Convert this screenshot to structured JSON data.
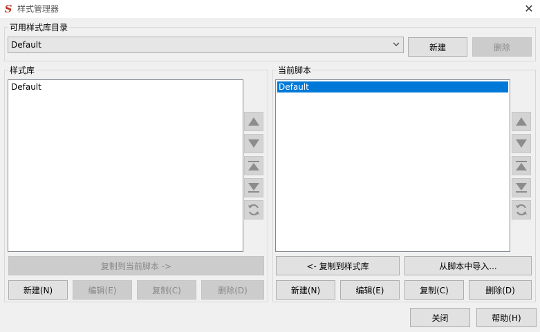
{
  "window": {
    "title": "样式管理器",
    "close_glyph": "✕",
    "app_icon_glyph": "S"
  },
  "catalog": {
    "group_label": "可用样式库目录",
    "selected_value": "Default",
    "new_label": "新建",
    "delete_label": "删除"
  },
  "library": {
    "group_label": "样式库",
    "items": [
      "Default"
    ],
    "copy_to_script_label": "复制到当前脚本 ->",
    "new_label": "新建(N)",
    "edit_label": "编辑(E)",
    "copy_label": "复制(C)",
    "delete_label": "删除(D)"
  },
  "script": {
    "group_label": "当前脚本",
    "items": [
      "Default"
    ],
    "copy_to_library_label": "<- 复制到样式库",
    "import_label": "从脚本中导入...",
    "new_label": "新建(N)",
    "edit_label": "编辑(E)",
    "copy_label": "复制(C)",
    "delete_label": "删除(D)"
  },
  "footer": {
    "close_label": "关闭",
    "help_label": "帮助(H)"
  },
  "icons": {
    "move_up": "triangle-up-icon",
    "move_down": "triangle-down-icon",
    "move_top": "move-to-top-icon",
    "move_bottom": "move-to-bottom-icon",
    "sort": "sort-icon"
  }
}
